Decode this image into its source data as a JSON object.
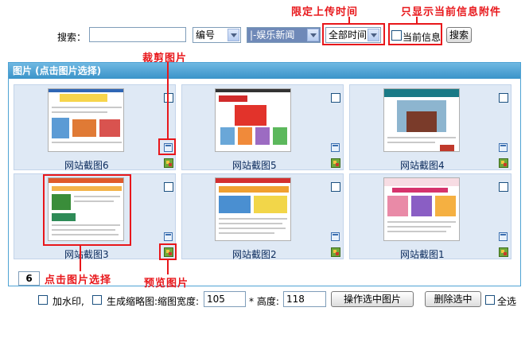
{
  "annotations": {
    "upload_time": "限定上传时间",
    "current_only": "只显示当前信息附件",
    "crop": "裁剪图片",
    "click_select": "点击图片选择",
    "preview": "预览图片"
  },
  "search": {
    "label": "搜索：",
    "input_value": "",
    "field_select": "编号",
    "category_select": "|-娱乐新闻",
    "time_select": "全部时间",
    "current_label": "当前信息",
    "search_button": "搜索"
  },
  "panel": {
    "title": "图片 (点击图片选择)",
    "images": [
      {
        "caption": "网站截图6"
      },
      {
        "caption": "网站截图5"
      },
      {
        "caption": "网站截图4"
      },
      {
        "caption": "网站截图3"
      },
      {
        "caption": "网站截图2"
      },
      {
        "caption": "网站截图1"
      }
    ],
    "count": "6"
  },
  "bottom": {
    "watermark_label": "加水印,",
    "thumbnail_label": "生成缩略图:缩图宽度:",
    "width_value": "105",
    "height_label": "* 高度:",
    "height_value": "118",
    "operate_button": "操作选中图片",
    "delete_button": "删除选中",
    "select_all_label": "全选"
  },
  "colors": {
    "accent_red": "#e8171b",
    "panel_header": "#3a93c9",
    "cell_bg": "#dfe9f5"
  }
}
